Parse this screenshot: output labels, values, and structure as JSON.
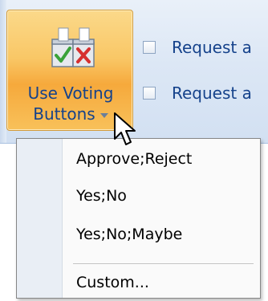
{
  "ribbon": {
    "voting_button": {
      "label_line1": "Use Voting",
      "label_line2": "Buttons",
      "icon": "ballot-boxes-icon"
    },
    "options": [
      {
        "label": "Request a",
        "checked": false
      },
      {
        "label": "Request a",
        "checked": false
      }
    ]
  },
  "menu": {
    "items": [
      {
        "label": "Approve;Reject"
      },
      {
        "label": "Yes;No"
      },
      {
        "label": "Yes;No;Maybe"
      },
      {
        "label": "Custom..."
      }
    ]
  },
  "colors": {
    "ribbon_text": "#15428b",
    "button_highlight": "#f9c766"
  }
}
